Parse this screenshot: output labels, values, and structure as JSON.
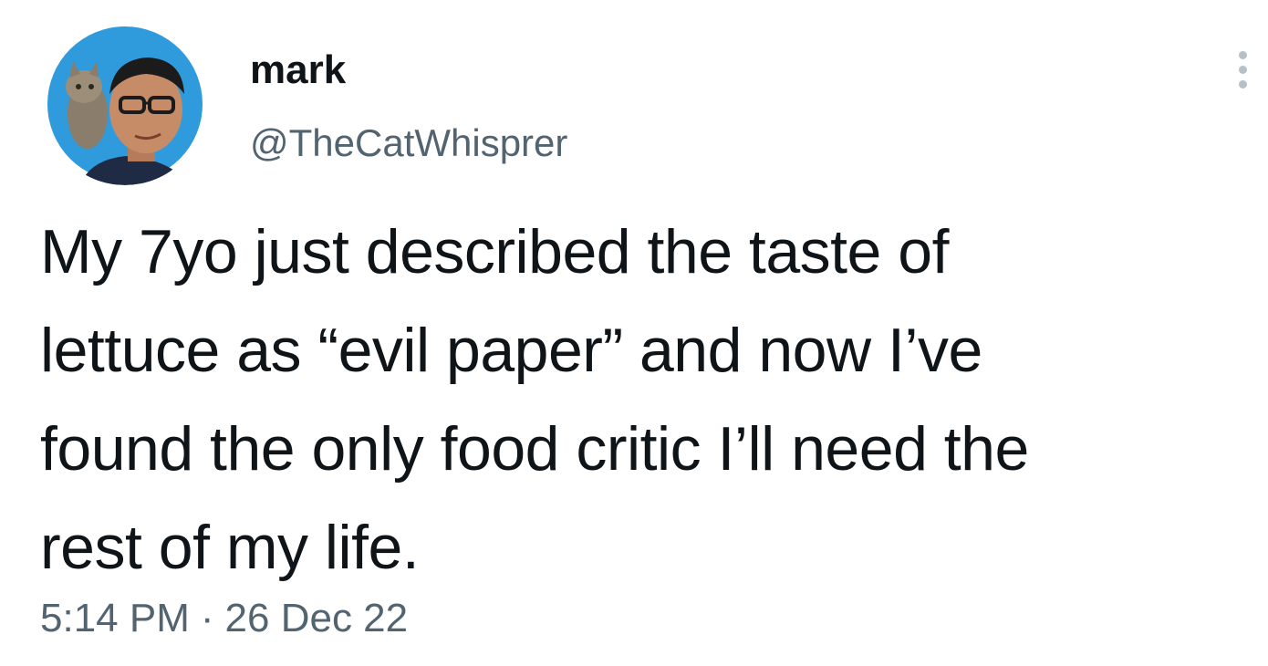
{
  "user": {
    "display_name": "mark",
    "handle": "@TheCatWhisprer",
    "avatar_icon": "profile-photo-man-with-cat",
    "avatar_bg": "#2f9bdc"
  },
  "tweet": {
    "text_lines": [
      "My 7yo just described the taste of",
      "lettuce as “evil paper” and now I’ve",
      "found the only food critic I’ll need the",
      "rest of my life."
    ],
    "time": "5:14 PM",
    "separator": "·",
    "date": "26 Dec 22"
  },
  "menu": {
    "icon": "more-vertical-icon"
  },
  "colors": {
    "text": "#0f1419",
    "secondary": "#536471"
  }
}
